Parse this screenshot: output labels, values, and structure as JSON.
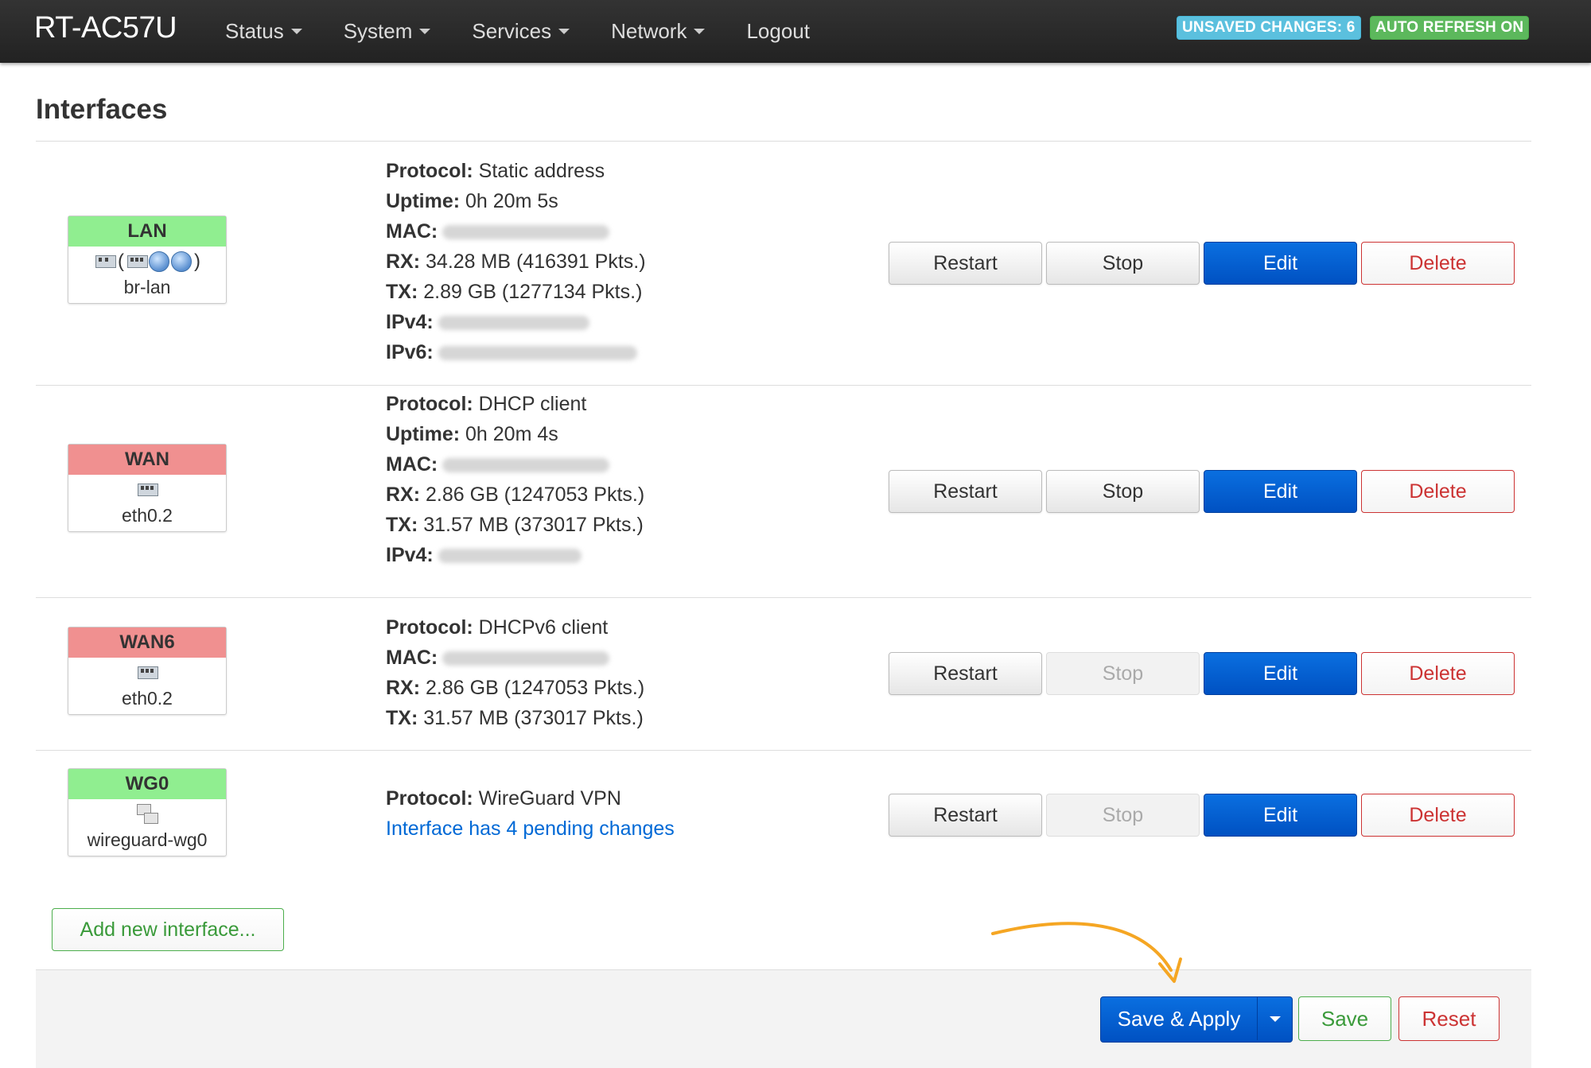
{
  "navbar": {
    "brand": "RT-AC57U",
    "menu": [
      {
        "label": "Status",
        "dropdown": true
      },
      {
        "label": "System",
        "dropdown": true
      },
      {
        "label": "Services",
        "dropdown": true
      },
      {
        "label": "Network",
        "dropdown": true
      },
      {
        "label": "Logout",
        "dropdown": false
      }
    ],
    "badges": {
      "unsaved": "UNSAVED CHANGES: 6",
      "refresh": "AUTO REFRESH ON"
    }
  },
  "page": {
    "title": "Interfaces"
  },
  "labels": {
    "protocol": "Protocol:",
    "uptime": "Uptime:",
    "mac": "MAC:",
    "rx": "RX:",
    "tx": "TX:",
    "ipv4": "IPv4:",
    "ipv6": "IPv6:"
  },
  "buttons": {
    "restart": "Restart",
    "stop": "Stop",
    "edit": "Edit",
    "delete": "Delete"
  },
  "interfaces": [
    {
      "name": "LAN",
      "state": "up",
      "device": "br-lan",
      "protocol": "Static address",
      "uptime": "0h 20m 5s",
      "rx": "34.28 MB (416391 Pkts.)",
      "tx": "2.89 GB (1277134 Pkts.)",
      "stop_enabled": true
    },
    {
      "name": "WAN",
      "state": "down",
      "device": "eth0.2",
      "protocol": "DHCP client",
      "uptime": "0h 20m 4s",
      "rx": "2.86 GB (1247053 Pkts.)",
      "tx": "31.57 MB (373017 Pkts.)",
      "stop_enabled": true
    },
    {
      "name": "WAN6",
      "state": "down",
      "device": "eth0.2",
      "protocol": "DHCPv6 client",
      "rx": "2.86 GB (1247053 Pkts.)",
      "tx": "31.57 MB (373017 Pkts.)",
      "stop_enabled": false
    },
    {
      "name": "WG0",
      "state": "up",
      "device": "wireguard-wg0",
      "protocol": "WireGuard VPN",
      "pending": "Interface has 4 pending changes",
      "stop_enabled": false
    }
  ],
  "actions": {
    "add_interface": "Add new interface...",
    "save_apply": "Save & Apply",
    "save": "Save",
    "reset": "Reset"
  },
  "colors": {
    "primary": "#0051c2",
    "success": "#4cae4c",
    "danger": "#cc3333",
    "iface_up": "#90ee90",
    "iface_down": "#f09090",
    "arrow": "#f5a623"
  }
}
